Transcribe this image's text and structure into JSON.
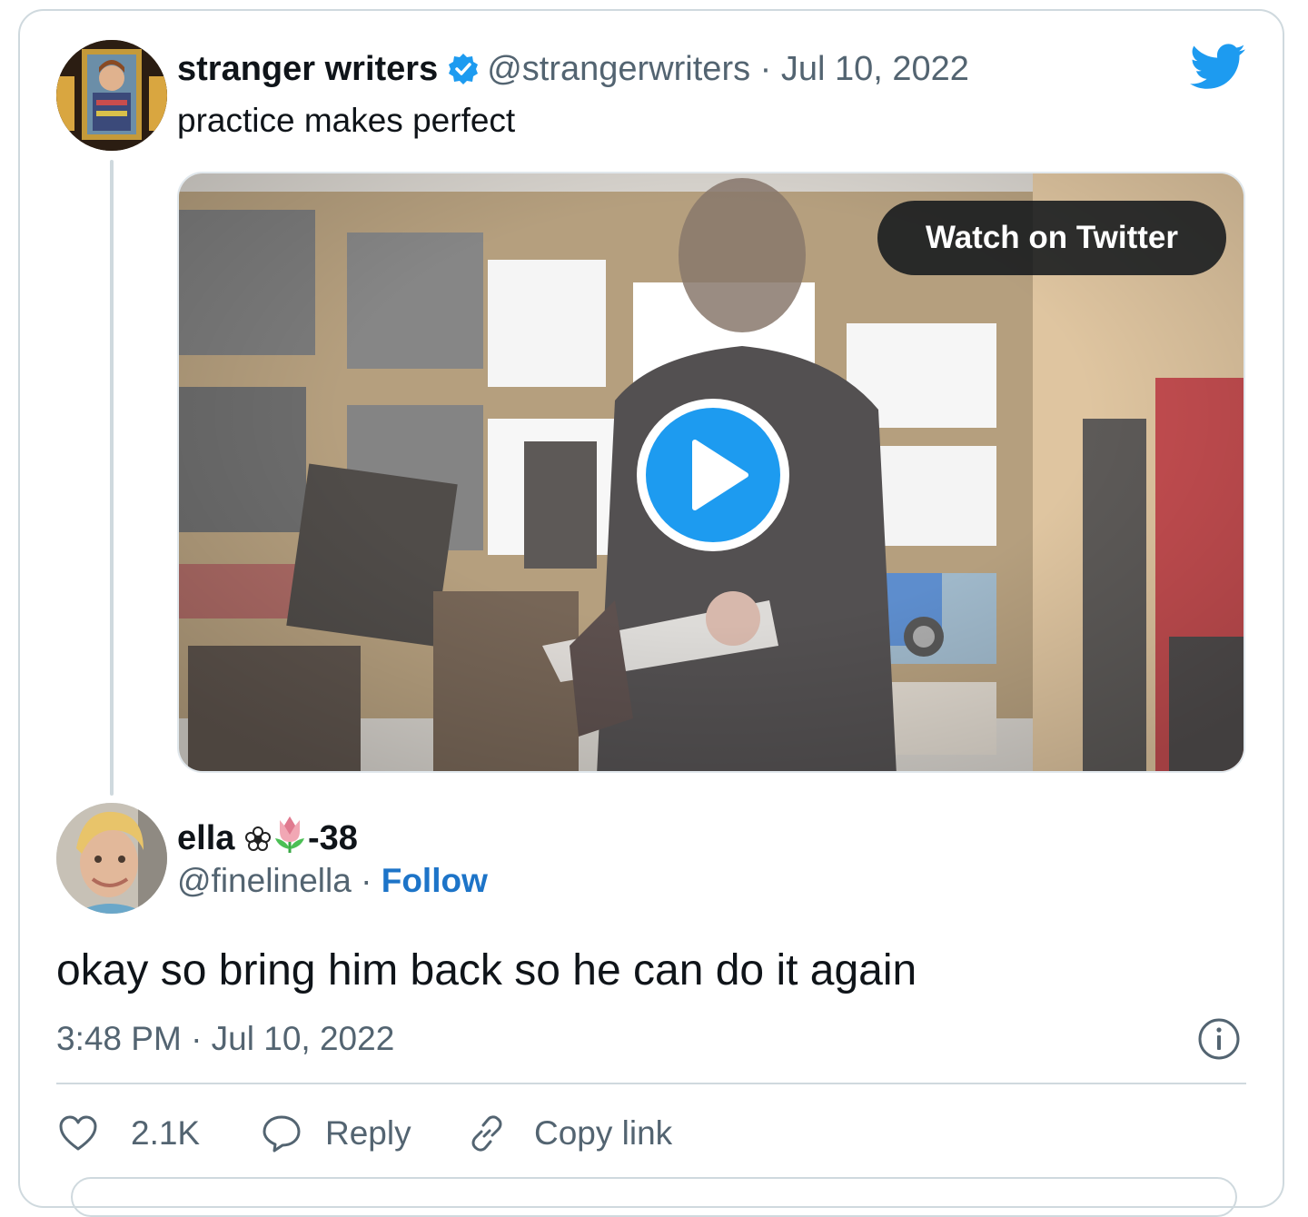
{
  "quoted_tweet": {
    "name": "stranger writers",
    "handle": "@strangerwriters",
    "separator": "·",
    "date": "Jul 10, 2022",
    "text": "practice makes perfect",
    "verified": true,
    "media": {
      "watch_label": "Watch on Twitter",
      "play_icon": "play-icon"
    }
  },
  "tweet": {
    "name": "ella",
    "name_suffix": "-38",
    "name_emoji": [
      "flower-icon",
      "tulip-icon"
    ],
    "handle": "@finelinella",
    "separator": "·",
    "follow_label": "Follow",
    "text": "okay so bring him back so he can do it again",
    "timestamp": "3:48 PM · Jul 10, 2022"
  },
  "actions": {
    "like_count": "2.1K",
    "reply_label": "Reply",
    "copy_link_label": "Copy link"
  },
  "colors": {
    "twitter_blue": "#1d9bf0",
    "follow_blue": "#1d74c8",
    "text_primary": "#0f1419",
    "text_secondary": "#536471",
    "border": "#cfd9de"
  }
}
